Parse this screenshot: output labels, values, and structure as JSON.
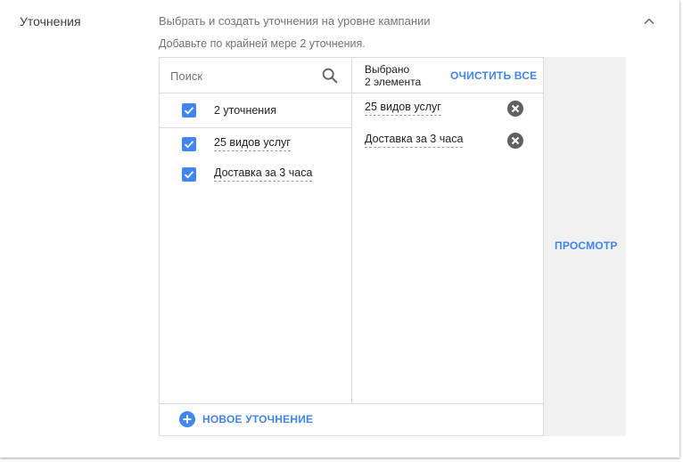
{
  "section": {
    "title": "Уточнения",
    "description": "Выбрать и создать уточнения на уровне кампании",
    "hint": "Добавьте по крайней мере 2 уточнения."
  },
  "search": {
    "placeholder": "Поиск",
    "value": ""
  },
  "list": {
    "all_label": "2 уточнения",
    "all_checked": true,
    "items": [
      {
        "label": "25 видов услуг",
        "checked": true
      },
      {
        "label": "Доставка за 3 часа",
        "checked": true
      }
    ]
  },
  "selected": {
    "title": "Выбрано",
    "count_text": "2 элемента",
    "clear_all_label": "ОЧИСТИТЬ ВСЕ",
    "items": [
      {
        "label": "25 видов услуг"
      },
      {
        "label": "Доставка за 3 часа"
      }
    ]
  },
  "footer": {
    "add_label": "НОВОЕ УТОЧНЕНИЕ"
  },
  "preview": {
    "label": "ПРОСМОТР"
  },
  "icons": {
    "collapse": "chevron-up-icon",
    "search": "search-icon",
    "check": "check-icon",
    "remove": "close-circle-icon",
    "add": "add-circle-icon"
  },
  "colors": {
    "accent": "#4285f4",
    "secondary_text": "#757575",
    "border": "#dadce0",
    "panel_bg": "#f1f1f1",
    "remove_icon": "#616161"
  }
}
